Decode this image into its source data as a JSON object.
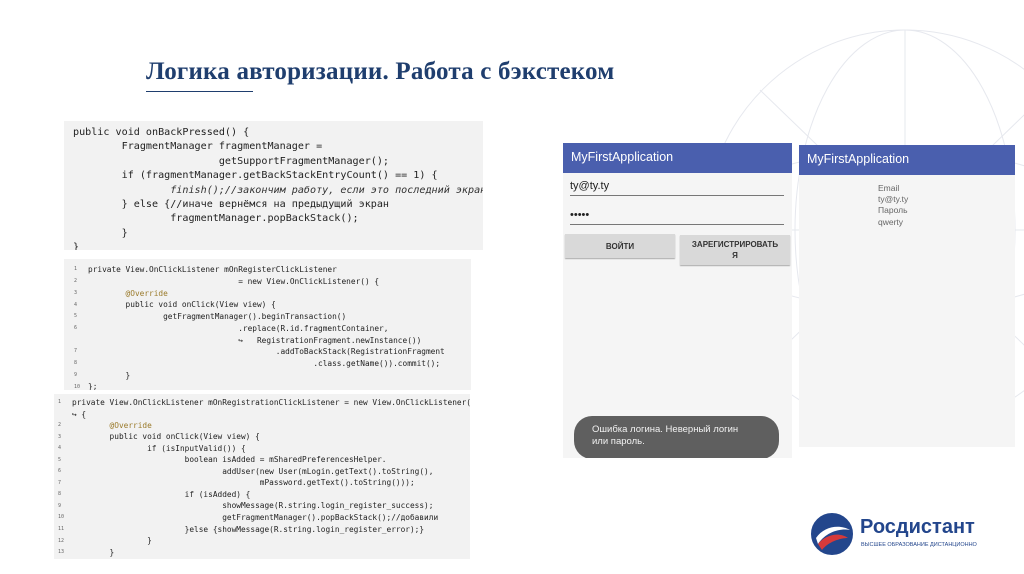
{
  "title": "Логика авторизации. Работа с бэкстеком",
  "code1": [
    "public void onBackPressed() {",
    "        FragmentManager fragmentManager =",
    "                        getSupportFragmentManager();",
    "        if (fragmentManager.getBackStackEntryCount() == 1) {",
    "                finish();//закончим работу, если это последний экран",
    "        } else {//иначе вернёмся на предыдущий экран",
    "                fragmentManager.popBackStack();",
    "        }",
    "}"
  ],
  "code2": [
    "private View.OnClickListener mOnRegisterClickListener",
    "                                = new View.OnClickListener() {",
    "        @Override",
    "        public void onClick(View view) {",
    "                getFragmentManager().beginTransaction()",
    "                                .replace(R.id.fragmentContainer,",
    "                                ↪   RegistrationFragment.newInstance())",
    "                                        .addToBackStack(RegistrationFragment",
    "                                                .class.getName()).commit();",
    "        }",
    "};"
  ],
  "code3": [
    "private View.OnClickListener mOnRegistrationClickListener = new View.OnClickListener()",
    "↪ {",
    "        @Override",
    "        public void onClick(View view) {",
    "                if (isInputValid()) {",
    "                        boolean isAdded = mSharedPreferencesHelper.",
    "                                addUser(new User(mLogin.getText().toString(),",
    "                                        mPassword.getText().toString()));",
    "                        if (isAdded) {",
    "                                showMessage(R.string.login_register_success);",
    "                                getFragmentManager().popBackStack();//добавили",
    "                        }else {showMessage(R.string.login_register_error);}",
    "                }",
    "        }",
    "};"
  ],
  "phone1": {
    "app_title": "MyFirstApplication",
    "login_value": "ty@ty.ty",
    "password_value": "•••••",
    "login_button": "ВОЙТИ",
    "register_button": "ЗАРЕГИСТРИРОВАТЬ",
    "register_button_wrap": "Я",
    "toast_line1": "Ошибка логина. Неверный логин",
    "toast_line2": "или пароль."
  },
  "phone2": {
    "app_title": "MyFirstApplication",
    "email_label": "Email",
    "email_value": "ty@ty.ty",
    "password_label": "Пароль",
    "password_value": "qwerty"
  },
  "logo": {
    "name": "Росдистант",
    "subtitle": "ВЫСШЕЕ ОБРАЗОВАНИЕ ДИСТАНЦИОННО"
  },
  "colors": {
    "title": "#1f3e6e",
    "appbar": "#4a5fae",
    "code_bg": "#f2f2f2",
    "logo_blue": "#23468c",
    "logo_red": "#d63a3a"
  }
}
